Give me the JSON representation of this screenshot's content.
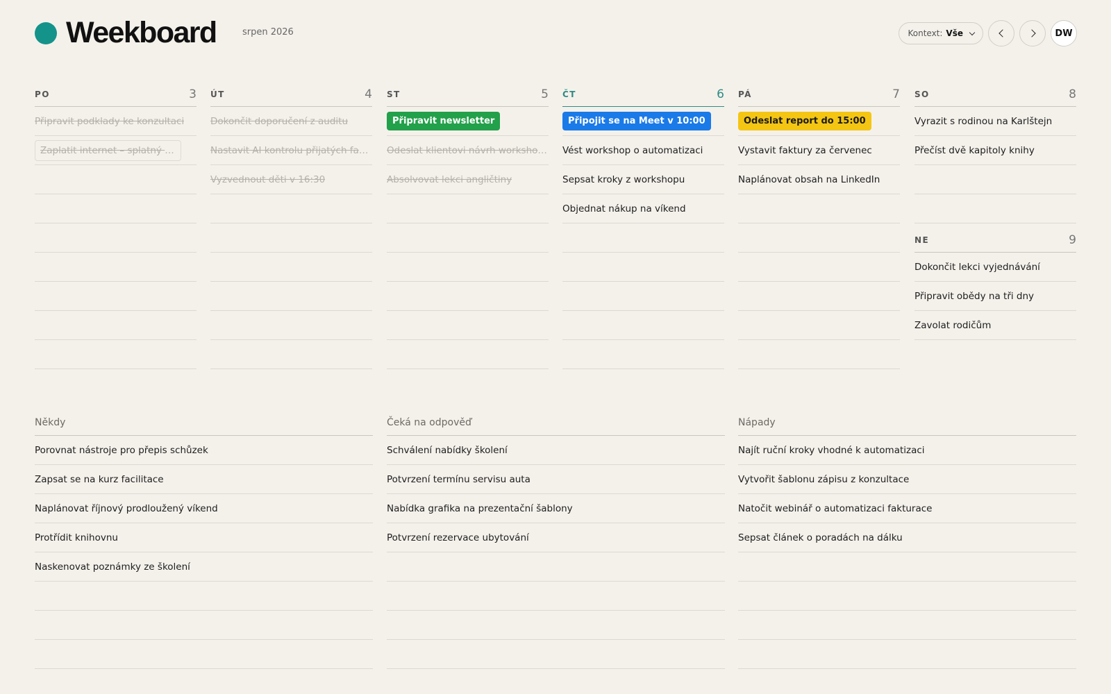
{
  "app": {
    "title": "Weekboard",
    "month": "srpen 2026"
  },
  "controls": {
    "context_label": "Kontext:",
    "context_value": "Vše",
    "avatar_initials": "DW"
  },
  "colors": {
    "accent": "#14938a",
    "today": "#2f8a84",
    "green_tag": "#22a04a",
    "blue_tag": "#1a7ae8",
    "yellow_tag": "#f4c613"
  },
  "days": [
    {
      "name": "PO",
      "num": "3",
      "today": false,
      "tasks": [
        {
          "text": "Připravit podklady ke konzultaci",
          "done": true
        },
        {
          "text": "Zaplatit internet – splatný do pátku",
          "done": true,
          "boxed": true
        }
      ]
    },
    {
      "name": "ÚT",
      "num": "4",
      "today": false,
      "tasks": [
        {
          "text": "Dokončit doporučení z auditu",
          "done": true
        },
        {
          "text": "Nastavit AI kontrolu přijatých faktur",
          "done": true
        },
        {
          "text": "Vyzvednout děti v 16:30",
          "done": true
        }
      ]
    },
    {
      "name": "ST",
      "num": "5",
      "today": false,
      "tasks": [
        {
          "text": "Připravit newsletter",
          "tag": "green"
        },
        {
          "text": "Odeslat klientovi návrh workshopu",
          "done": true
        },
        {
          "text": "Absolvovat lekci angličtiny",
          "done": true
        }
      ]
    },
    {
      "name": "ČT",
      "num": "6",
      "today": true,
      "tasks": [
        {
          "text": "Připojit se na Meet v 10:00",
          "tag": "blue"
        },
        {
          "text": "Vést workshop o automatizaci"
        },
        {
          "text": "Sepsat kroky z workshopu"
        },
        {
          "text": "Objednat nákup na víkend"
        }
      ]
    },
    {
      "name": "PÁ",
      "num": "7",
      "today": false,
      "tasks": [
        {
          "text": "Odeslat report do 15:00",
          "tag": "yellow"
        },
        {
          "text": "Vystavit faktury za červenec"
        },
        {
          "text": "Naplánovat obsah na LinkedIn"
        }
      ]
    },
    {
      "name": "SO",
      "num": "8",
      "today": false,
      "tasks": [
        {
          "text": "Vyrazit s rodinou na Karlštejn"
        },
        {
          "text": "Přečíst dvě kapitoly knihy"
        }
      ]
    },
    {
      "name": "NE",
      "num": "9",
      "today": false,
      "tasks": [
        {
          "text": "Dokončit lekci vyjednávání"
        },
        {
          "text": "Připravit obědy na tři dny"
        },
        {
          "text": "Zavolat rodičům"
        }
      ]
    }
  ],
  "lists": [
    {
      "title": "Někdy",
      "items": [
        "Porovnat nástroje pro přepis schůzek",
        "Zapsat se na kurz facilitace",
        "Naplánovat říjnový prodloužený víkend",
        "Protřídit knihovnu",
        "Naskenovat poznámky ze školení"
      ]
    },
    {
      "title": "Čeká na odpověď",
      "items": [
        "Schválení nabídky školení",
        "Potvrzení termínu servisu auta",
        "Nabídka grafika na prezentační šablony",
        "Potvrzení rezervace ubytování"
      ]
    },
    {
      "title": "Nápady",
      "items": [
        "Najít ruční kroky vhodné k automatizaci",
        "Vytvořit šablonu zápisu z konzultace",
        "Natočit webinář o automatizaci fakturace",
        "Sepsat článek o poradách na dálku"
      ]
    }
  ]
}
